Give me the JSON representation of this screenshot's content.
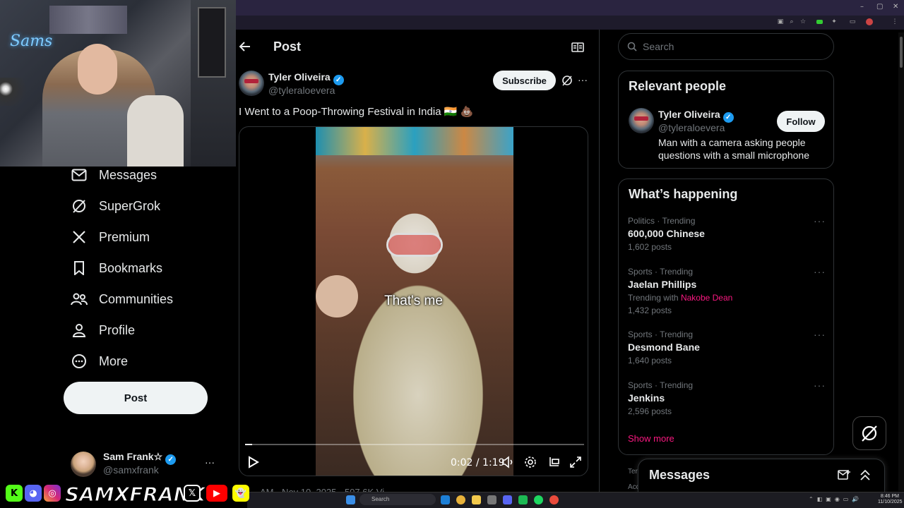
{
  "browser": {
    "window_controls": [
      "–",
      "▢",
      "✕"
    ]
  },
  "webcam": {
    "neon_sign": "Sams"
  },
  "nav": {
    "items": [
      {
        "label": "Messages",
        "icon": "envelope-icon"
      },
      {
        "label": "SuperGrok",
        "icon": "grok-icon"
      },
      {
        "label": "Premium",
        "icon": "x-logo-icon"
      },
      {
        "label": "Bookmarks",
        "icon": "bookmark-icon"
      },
      {
        "label": "Communities",
        "icon": "communities-icon"
      },
      {
        "label": "Profile",
        "icon": "person-icon"
      },
      {
        "label": "More",
        "icon": "more-circle-icon"
      }
    ],
    "post_button": "Post",
    "account": {
      "name": "Sam Frank☆",
      "handle": "@samxfrank",
      "more": "···"
    }
  },
  "post": {
    "header_title": "Post",
    "author_name": "Tyler Oliveira",
    "author_handle": "@tyleraloevera",
    "subscribe_label": "Subscribe",
    "more": "···",
    "text": "I Went to a Poop-Throwing Festival in India 🇮🇳 💩",
    "video": {
      "caption": "That's me",
      "time": "0:02 / 1:19",
      "progress": 0.02
    },
    "meta_partial": "AM · Nov 10, 2025 · 507.6K Vi"
  },
  "sidebar": {
    "search_placeholder": "Search",
    "relevant": {
      "title": "Relevant people",
      "name": "Tyler Oliveira",
      "handle": "@tyleraloevera",
      "follow_label": "Follow",
      "bio": "Man with a camera asking people questions with a small microphone"
    },
    "happening": {
      "title": "What’s happening",
      "trends": [
        {
          "category": "Politics · Trending",
          "name": "600,000 Chinese",
          "count": "1,602 posts"
        },
        {
          "category": "Sports · Trending",
          "name": "Jaelan Phillips",
          "with_label": "Trending with",
          "with_link": "Nakobe Dean",
          "count": "1,432 posts"
        },
        {
          "category": "Sports · Trending",
          "name": "Desmond Bane",
          "count": "1,640 posts"
        },
        {
          "category": "Sports · Trending",
          "name": "Jenkins",
          "count": "2,596 posts"
        }
      ],
      "show_more": "Show more"
    },
    "footer_partial": [
      "Ter",
      "Acc"
    ],
    "messages_title": "Messages"
  },
  "taskbar": {
    "search_label": "Search",
    "time": "8:46 PM",
    "date": "11/10/2025"
  },
  "stream_overlay": {
    "handle": "SAMXFRANK",
    "socials": [
      "K",
      "discord-icon",
      "instagram-icon",
      "x-icon",
      "youtube-icon",
      "snapchat-icon"
    ]
  },
  "colors": {
    "accent": "#1d9bf0",
    "link_pink": "#f91880",
    "background": "#000000",
    "border": "#2f3336"
  }
}
